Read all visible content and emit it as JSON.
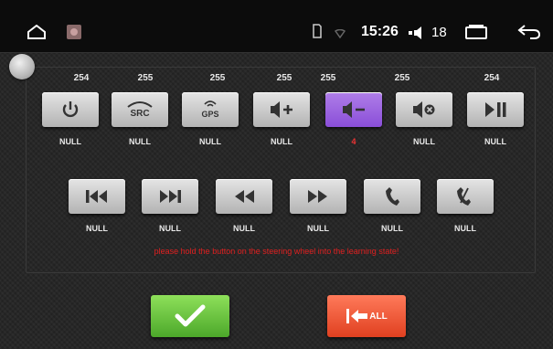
{
  "status_bar": {
    "time": "15:26",
    "volume": "18",
    "icons": [
      "home-icon",
      "app-icon",
      "sim-icon",
      "wifi-icon",
      "volume-icon",
      "recents-icon",
      "back-icon"
    ]
  },
  "colors": {
    "active_key": "#9a60e0",
    "hint_text": "#e02020",
    "confirm": "#5cb832",
    "reset": "#f05a38"
  },
  "slider": {
    "value": 0
  },
  "row1": [
    {
      "icon": "power-icon",
      "value": "254",
      "label": "NULL",
      "active": false
    },
    {
      "icon": "src-icon",
      "text": "SRC",
      "value": "255",
      "label": "NULL",
      "active": false
    },
    {
      "icon": "gps-icon",
      "text": "GPS",
      "value": "255",
      "label": "NULL",
      "active": false
    },
    {
      "icon": "volume-up-icon",
      "value": "255",
      "label": "NULL",
      "active": false
    },
    {
      "icon": "volume-down-icon",
      "value": "255",
      "label": "4",
      "active": true
    },
    {
      "icon": "mute-icon",
      "value": "255",
      "label": "NULL",
      "active": false
    },
    {
      "icon": "play-pause-icon",
      "value": "254",
      "label": "NULL",
      "active": false
    }
  ],
  "row2": [
    {
      "icon": "previous-track-icon",
      "label": "NULL"
    },
    {
      "icon": "next-track-icon",
      "label": "NULL"
    },
    {
      "icon": "rewind-icon",
      "label": "NULL"
    },
    {
      "icon": "fast-forward-icon",
      "label": "NULL"
    },
    {
      "icon": "call-answer-icon",
      "label": "NULL"
    },
    {
      "icon": "call-hangup-icon",
      "label": "NULL"
    }
  ],
  "hint": "please hold the button on the steering wheel into the learning state!",
  "buttons": {
    "confirm_icon": "checkmark-icon",
    "reset_label": "ALL"
  }
}
